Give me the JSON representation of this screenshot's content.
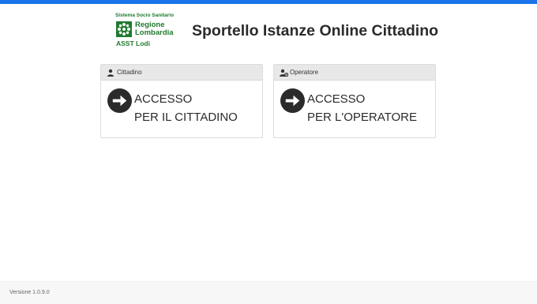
{
  "brand": {
    "tagline": "Sistema Socio Sanitario",
    "region_line1": "Regione",
    "region_line2": "Lombardia",
    "agency": "ASST Lodi"
  },
  "header": {
    "title": "Sportello Istanze Online Cittadino"
  },
  "cards": [
    {
      "header_label": "Cittadino",
      "header_icon": "user-icon",
      "line1": "ACCESSO",
      "line2": "PER IL CITTADINO",
      "action_icon": "arrow-right-circle-icon"
    },
    {
      "header_label": "Operatore",
      "header_icon": "user-gear-icon",
      "line1": "ACCESSO",
      "line2": "PER L'OPERATORE",
      "action_icon": "arrow-right-circle-icon"
    }
  ],
  "footer": {
    "version": "Versione 1.0.9.0"
  },
  "colors": {
    "accent": "#1a73e8",
    "brand_green": "#1e7a2e",
    "card_header_bg": "#e8e8e8",
    "arrow_fill": "#2b2b2b"
  }
}
